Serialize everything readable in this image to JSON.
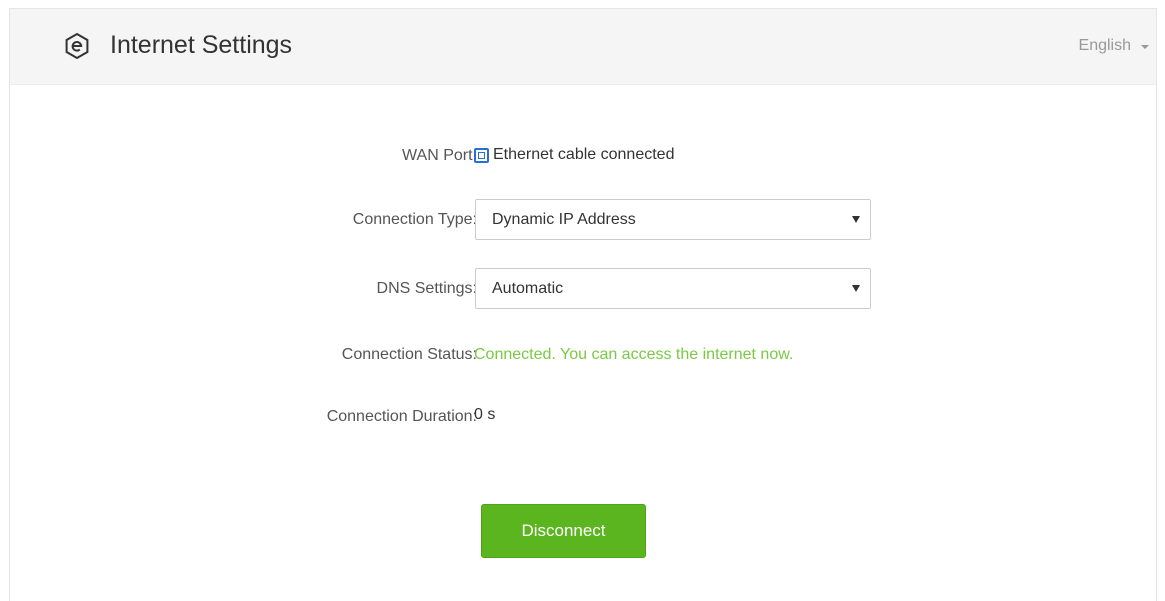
{
  "header": {
    "title": "Internet Settings",
    "language": "English",
    "logo_icon": "e-logo-icon"
  },
  "form": {
    "wan_port": {
      "label": "WAN Port:",
      "value": "Ethernet cable connected",
      "icon": "ethernet-port-icon"
    },
    "connection_type": {
      "label": "Connection Type:",
      "selected": "Dynamic IP Address"
    },
    "dns_settings": {
      "label": "DNS Settings:",
      "selected": "Automatic"
    },
    "connection_status": {
      "label": "Connection Status:",
      "value": "Connected. You can access the internet now.",
      "color": "#7ac943"
    },
    "connection_duration": {
      "label": "Connection Duration:",
      "value": "0 s"
    }
  },
  "actions": {
    "disconnect_label": "Disconnect",
    "button_color": "#5bb51e"
  }
}
